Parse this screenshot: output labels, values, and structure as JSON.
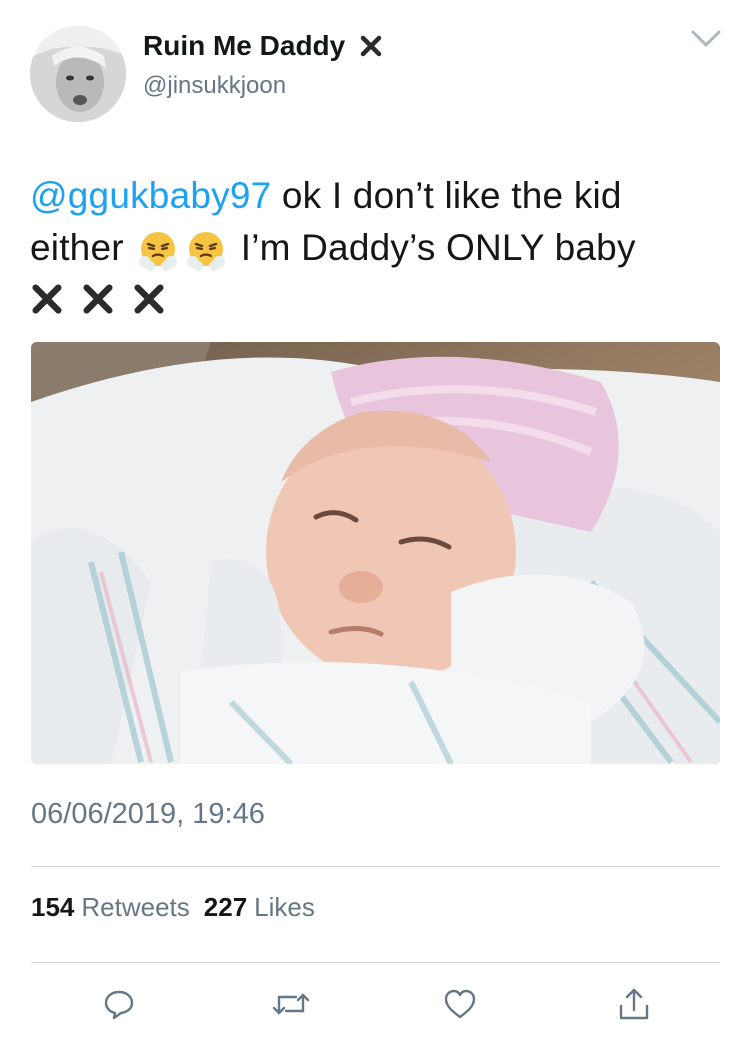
{
  "user": {
    "display_name": "Ruin Me Daddy",
    "handle": "@jinsukkjoon",
    "name_emoji": "cross-mark-emoji"
  },
  "tweet": {
    "mention": "@ggukbaby97",
    "text_part1": " ok I don’t like the kid either ",
    "text_part2": " I’m Daddy’s ONLY baby",
    "inline_emojis": [
      "face-with-steam-emoji",
      "face-with-steam-emoji"
    ],
    "trailing_emojis": [
      "cross-mark-emoji",
      "cross-mark-emoji",
      "cross-mark-emoji"
    ]
  },
  "media": {
    "description_icon": "photo"
  },
  "meta": {
    "timestamp": "06/06/2019, 19:46"
  },
  "stats": {
    "retweets_count": "154",
    "retweets_label": "Retweets",
    "likes_count": "227",
    "likes_label": "Likes"
  },
  "actions": [
    "reply-icon",
    "retweet-icon",
    "like-icon",
    "share-icon"
  ],
  "colors": {
    "accent": "#1da1f2",
    "secondary_text": "#657786",
    "divider": "#d3d9de",
    "icon": "#657786"
  }
}
